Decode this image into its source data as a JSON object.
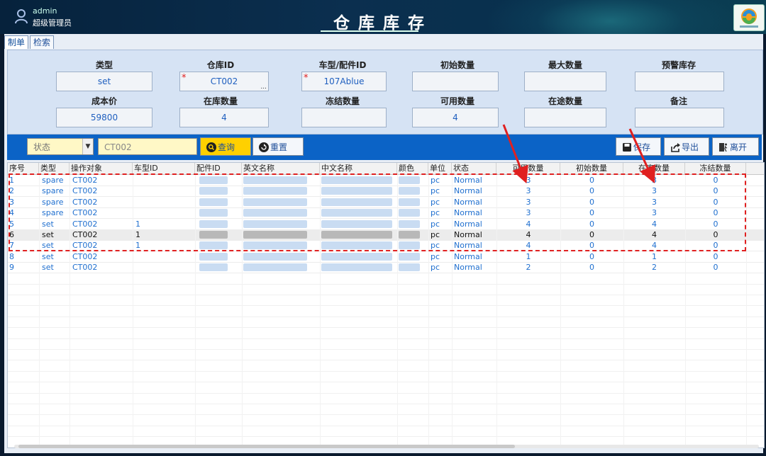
{
  "header": {
    "user_name": "admin",
    "user_role": "超级管理员",
    "title": "仓库库存",
    "logo_icon": "company-logo"
  },
  "tabs": [
    {
      "label": "制单",
      "active": true
    },
    {
      "label": "检索",
      "active": false
    }
  ],
  "form": {
    "row1": [
      {
        "label": "类型",
        "value": "set",
        "required": false
      },
      {
        "label": "仓库ID",
        "value": "CT002",
        "required": true,
        "has_picker": true
      },
      {
        "label": "车型/配件ID",
        "value": "107Ablue",
        "required": true
      },
      {
        "label": "初始数量",
        "value": ""
      },
      {
        "label": "最大数量",
        "value": ""
      },
      {
        "label": "预警库存",
        "value": ""
      }
    ],
    "row2": [
      {
        "label": "成本价",
        "value": "59800"
      },
      {
        "label": "在库数量",
        "value": "4"
      },
      {
        "label": "冻结数量",
        "value": ""
      },
      {
        "label": "可用数量",
        "value": "4"
      },
      {
        "label": "在途数量",
        "value": ""
      },
      {
        "label": "备注",
        "value": ""
      }
    ],
    "picker_dots": "..."
  },
  "toolbar": {
    "status_placeholder": "状态",
    "search_value": "CT002",
    "query_label": "查询",
    "reset_label": "重置",
    "save_label": "保存",
    "export_label": "导出",
    "exit_label": "离开"
  },
  "table": {
    "columns": [
      "序号",
      "类型",
      "操作对象",
      "车型ID",
      "配件ID",
      "英文名称",
      "中文名称",
      "颜色",
      "单位",
      "状态",
      "可用数量",
      "初始数量",
      "在库数量",
      "冻结数量"
    ],
    "rows": [
      {
        "no": "1",
        "type": "spare",
        "target": "CT002",
        "car_id": "",
        "unit": "pc",
        "status": "Normal",
        "available": "3",
        "initial": "0",
        "in_stock": "3",
        "frozen": "0"
      },
      {
        "no": "2",
        "type": "spare",
        "target": "CT002",
        "car_id": "",
        "unit": "pc",
        "status": "Normal",
        "available": "3",
        "initial": "0",
        "in_stock": "3",
        "frozen": "0"
      },
      {
        "no": "3",
        "type": "spare",
        "target": "CT002",
        "car_id": "",
        "unit": "pc",
        "status": "Normal",
        "available": "3",
        "initial": "0",
        "in_stock": "3",
        "frozen": "0"
      },
      {
        "no": "4",
        "type": "spare",
        "target": "CT002",
        "car_id": "",
        "unit": "pc",
        "status": "Normal",
        "available": "3",
        "initial": "0",
        "in_stock": "3",
        "frozen": "0"
      },
      {
        "no": "5",
        "type": "set",
        "target": "CT002",
        "car_id": "1",
        "unit": "pc",
        "status": "Normal",
        "available": "4",
        "initial": "0",
        "in_stock": "4",
        "frozen": "0"
      },
      {
        "no": "6",
        "type": "set",
        "target": "CT002",
        "car_id": "1",
        "unit": "pc",
        "status": "Normal",
        "available": "4",
        "initial": "0",
        "in_stock": "4",
        "frozen": "0",
        "selected": true
      },
      {
        "no": "7",
        "type": "set",
        "target": "CT002",
        "car_id": "1",
        "unit": "pc",
        "status": "Normal",
        "available": "4",
        "initial": "0",
        "in_stock": "4",
        "frozen": "0"
      },
      {
        "no": "8",
        "type": "set",
        "target": "CT002",
        "car_id": "",
        "unit": "pc",
        "status": "Normal",
        "available": "1",
        "initial": "0",
        "in_stock": "1",
        "frozen": "0"
      },
      {
        "no": "9",
        "type": "set",
        "target": "CT002",
        "car_id": "",
        "unit": "pc",
        "status": "Normal",
        "available": "2",
        "initial": "0",
        "in_stock": "2",
        "frozen": "0"
      }
    ]
  },
  "colors": {
    "accent_blue": "#0b63c6",
    "query_yellow": "#ffd000",
    "annotation_red": "#e02020",
    "link_blue": "#1f6fcf"
  }
}
